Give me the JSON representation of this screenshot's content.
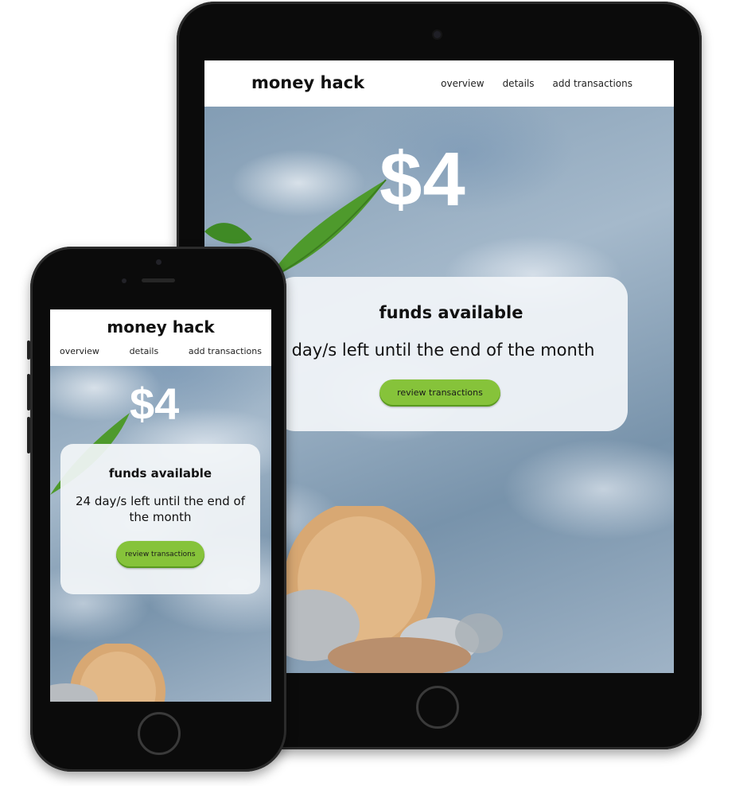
{
  "tablet": {
    "logo": "money hack",
    "nav": [
      "overview",
      "details",
      "add transactions"
    ],
    "amount": "$4",
    "card": {
      "title": "funds available",
      "days_text": "day/s left until the end of the month",
      "button": "review transactions"
    }
  },
  "phone": {
    "logo": "money hack",
    "nav": [
      "overview",
      "details",
      "add transactions"
    ],
    "amount": "$4",
    "card": {
      "title": "funds available",
      "days_text": "24 day/s left until the end of the month",
      "button": "review transactions"
    }
  },
  "colors": {
    "accent_button": "#86c33a",
    "device_body": "#0b0b0b",
    "card_background": "#f2f5f8"
  }
}
